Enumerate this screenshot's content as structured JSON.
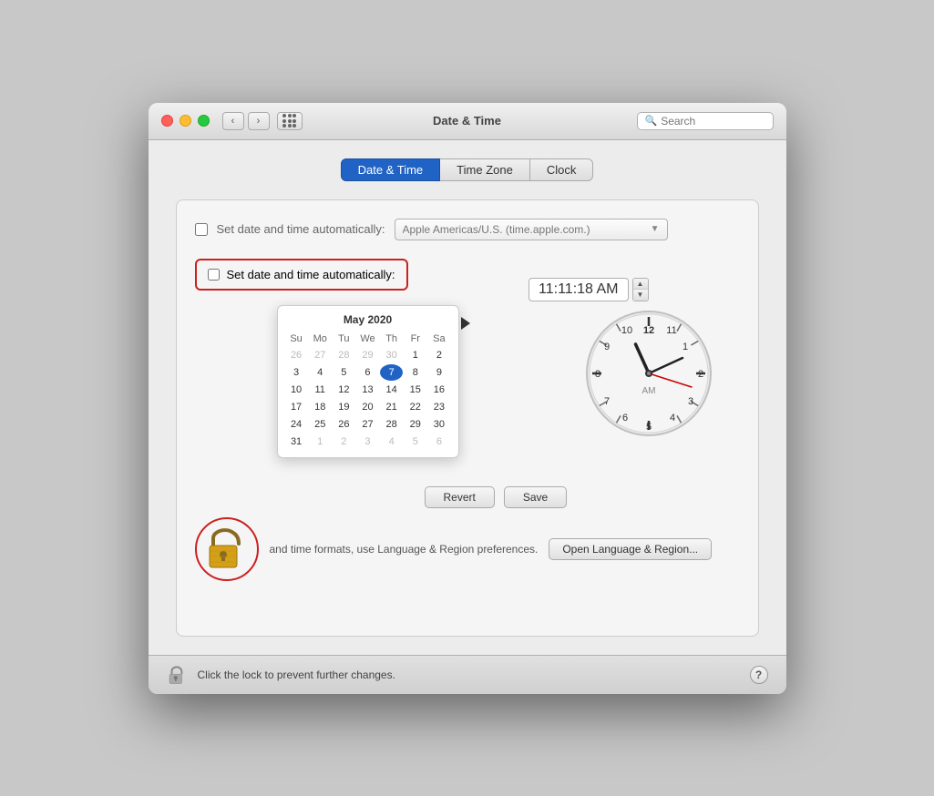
{
  "window": {
    "title": "Date & Time"
  },
  "titlebar": {
    "search_placeholder": "Search"
  },
  "tabs": [
    {
      "id": "date-time",
      "label": "Date & Time",
      "active": true
    },
    {
      "id": "time-zone",
      "label": "Time Zone",
      "active": false
    },
    {
      "id": "clock",
      "label": "Clock",
      "active": false
    }
  ],
  "auto_checkbox_top": {
    "label": "Set date and time automatically:",
    "checked": false,
    "dropdown_value": "Apple Americas/U.S. (time.apple.com.)"
  },
  "highlighted_checkbox": {
    "label": "Set date and time automatically:",
    "checked": false
  },
  "calendar": {
    "month_year": "May 2020",
    "days_of_week": [
      "Su",
      "Mo",
      "Tu",
      "We",
      "Th",
      "Fr",
      "Sa"
    ],
    "weeks": [
      [
        "",
        "1",
        "2",
        "3",
        "4",
        "5",
        "6"
      ],
      [
        "7",
        "8",
        "9",
        "10",
        "11",
        "12",
        "13",
        "14"
      ],
      [
        "15",
        "16",
        "17",
        "18",
        "19",
        "20",
        "21"
      ],
      [
        "22",
        "23",
        "24",
        "25",
        "26",
        "27",
        "28"
      ],
      [
        "29",
        "30",
        "31",
        "",
        "1",
        "2",
        "3",
        "4"
      ],
      [
        "5",
        "6",
        "7",
        "8",
        "9",
        "10",
        "11"
      ]
    ],
    "today_day": "7",
    "today_week_index": 0
  },
  "time": {
    "display": "11:11:18 AM"
  },
  "clock": {
    "hour": 11,
    "minute": 11,
    "second": 18,
    "am_pm": "AM"
  },
  "buttons": {
    "revert": "Revert",
    "save": "Save"
  },
  "notice": {
    "text": "and time formats, use Language & Region preferences.",
    "open_button": "Open Language & Region..."
  },
  "bottom_bar": {
    "lock_text": "Click the lock to prevent further changes."
  }
}
